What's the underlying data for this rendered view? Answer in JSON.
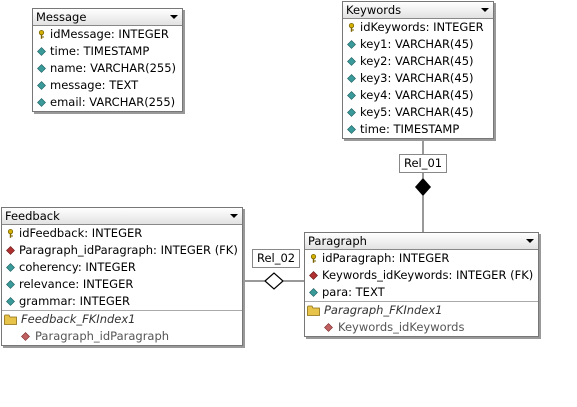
{
  "entities": {
    "message": {
      "name": "Message",
      "columns": [
        {
          "text": "idMessage: INTEGER"
        },
        {
          "text": "time: TIMESTAMP"
        },
        {
          "text": "name: VARCHAR(255)"
        },
        {
          "text": "message: TEXT"
        },
        {
          "text": "email: VARCHAR(255)"
        }
      ]
    },
    "keywords": {
      "name": "Keywords",
      "columns": [
        {
          "text": "idKeywords: INTEGER"
        },
        {
          "text": "key1: VARCHAR(45)"
        },
        {
          "text": "key2: VARCHAR(45)"
        },
        {
          "text": "key3: VARCHAR(45)"
        },
        {
          "text": "key4: VARCHAR(45)"
        },
        {
          "text": "key5: VARCHAR(45)"
        },
        {
          "text": "time: TIMESTAMP"
        }
      ]
    },
    "feedback": {
      "name": "Feedback",
      "columns": [
        {
          "text": "idFeedback: INTEGER"
        },
        {
          "text": "Paragraph_idParagraph: INTEGER (FK)"
        },
        {
          "text": "coherency: INTEGER"
        },
        {
          "text": "relevance: INTEGER"
        },
        {
          "text": "grammar: INTEGER"
        }
      ],
      "index_name": "Feedback_FKIndex1",
      "index_column": "Paragraph_idParagraph"
    },
    "paragraph": {
      "name": "Paragraph",
      "columns": [
        {
          "text": "idParagraph: INTEGER"
        },
        {
          "text": "Keywords_idKeywords: INTEGER (FK)"
        },
        {
          "text": "para: TEXT"
        }
      ],
      "index_name": "Paragraph_FKIndex1",
      "index_column": "Keywords_idKeywords"
    }
  },
  "relations": {
    "rel1": "Rel_01",
    "rel2": "Rel_02"
  },
  "colors": {
    "key": "#d4b000",
    "attribute": "#3a9a9a",
    "foreign_key": "#b03030",
    "folder": "#e8c34a"
  }
}
